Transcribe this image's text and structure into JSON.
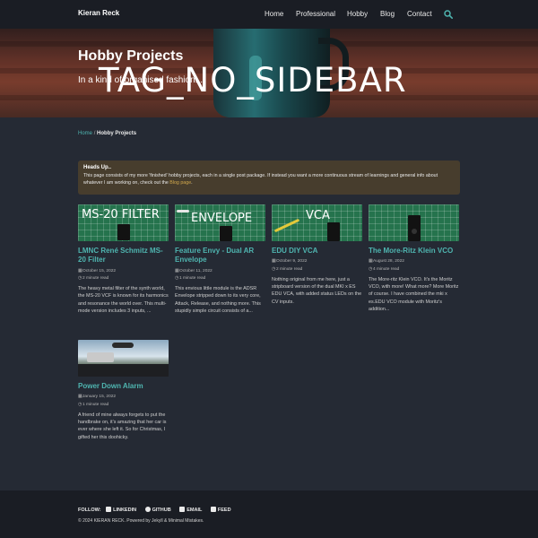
{
  "site": {
    "title": "Kieran Reck"
  },
  "nav": {
    "items": [
      "Home",
      "Professional",
      "Hobby",
      "Blog",
      "Contact"
    ]
  },
  "hero": {
    "title": "Hobby Projects",
    "subtitle": "In a kind of organised fashion...",
    "watermark": "TAG_NO_SIDEBAR"
  },
  "breadcrumb": {
    "home": "Home",
    "separator": "/",
    "current": "Hobby Projects"
  },
  "notice": {
    "title": "Heads Up..",
    "body_before": "This page consists of my more 'finished' hobby projects, each in a single post package. If instead you want a more continuous stream of learnings and general info about whatever I am working on, check out the ",
    "link": "Blog page",
    "body_after": "."
  },
  "cards": [
    {
      "thumb_label": "MS-20 FILTER",
      "title": "LMNC René Schmitz MS-20 Filter",
      "date": "October 15, 2022",
      "read_time": "2 minute read",
      "excerpt": "The heavy metal filter of the synth world, the MS-20 VCF is known for its harmonics and resonance the world over. This multi-mode version includes 3 inputs, ..."
    },
    {
      "thumb_label": "ENVELOPE",
      "title": "Feature Envy - Dual AR Envelope",
      "date": "October 11, 2022",
      "read_time": "1 minute read",
      "excerpt": "This envious little module is the ADSR Envelope stripped down to its very core, Attack, Release, and nothing more. This stupidly simple circuit consists of a..."
    },
    {
      "thumb_label": "VCA",
      "title": "EDU DIY VCA",
      "date": "October 9, 2022",
      "read_time": "2 minute read",
      "excerpt": "Nothing original from me here, just a stripboard version of the dual MKI x ES EDU VCA, with added status LEDs on the CV inputs."
    },
    {
      "thumb_label": "",
      "title": "The More-Ritz Klein VCO",
      "date": "August 28, 2022",
      "read_time": "4 minute read",
      "excerpt": "The More-ritz Klein VCO. It's the Moritz VCO, with more! What more? More Moritz of course. I have combined the mki x es.EDU VCO module with Moritz's addition..."
    },
    {
      "thumb_label": "",
      "title": "Power Down Alarm",
      "date": "January 15, 2022",
      "read_time": "1 minute read",
      "excerpt": "A friend of mine always forgets to put the handbrake on, it's amazing that her car is ever where she left it. So for Christmas, I gifted her this doohicky."
    }
  ],
  "footer": {
    "follow_label": "FOLLOW:",
    "links": [
      "LINKEDIN",
      "GITHUB",
      "EMAIL",
      "FEED"
    ],
    "copyright": "© 2024 KIERAN RECK. Powered by Jekyll & Minimal Mistakes."
  },
  "colors": {
    "accent": "#4fb5b0",
    "background": "#252a34",
    "header": "#1a1d24",
    "notice_bg": "#473d2d",
    "notice_link": "#d3a94c"
  }
}
